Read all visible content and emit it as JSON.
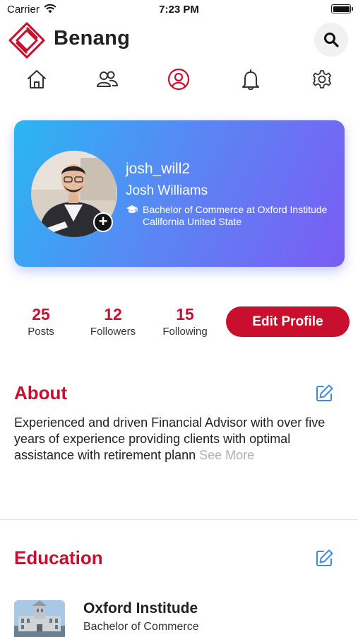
{
  "status_bar": {
    "carrier": "Carrier",
    "time": "7:23 PM"
  },
  "header": {
    "app_name": "Benang",
    "logo_icon": "benang-logo-icon",
    "search_icon": "search-icon"
  },
  "nav": {
    "items": [
      {
        "name": "home",
        "icon": "home-icon",
        "active": false
      },
      {
        "name": "friends",
        "icon": "people-icon",
        "active": false
      },
      {
        "name": "profile",
        "icon": "user-circle-icon",
        "active": true
      },
      {
        "name": "notifications",
        "icon": "bell-icon",
        "active": false
      },
      {
        "name": "settings",
        "icon": "gear-icon",
        "active": false
      }
    ],
    "active_color": "#c8102e"
  },
  "profile": {
    "username": "josh_will2",
    "full_name": "Josh Williams",
    "education_line": "Bachelor of Commerce at Oxford Institude California United State",
    "add_photo_symbol": "+"
  },
  "stats": {
    "posts": {
      "value": "25",
      "label": "Posts"
    },
    "followers": {
      "value": "12",
      "label": "Followers"
    },
    "following": {
      "value": "15",
      "label": "Following"
    }
  },
  "edit_profile_label": "Edit Profile",
  "about": {
    "title": "About",
    "text": "Experienced and driven Financial Advisor with over five years of experience providing clients with optimal assistance with retirement plann",
    "see_more": "See More"
  },
  "education": {
    "title": "Education",
    "items": [
      {
        "school": "Oxford Institude",
        "degree": "Bachelor of Commerce"
      }
    ]
  },
  "colors": {
    "brand_red": "#c8102e",
    "card_gradient_start": "#2ab6f3",
    "card_gradient_end": "#7b5cf4",
    "edit_icon": "#3a8fdc"
  }
}
